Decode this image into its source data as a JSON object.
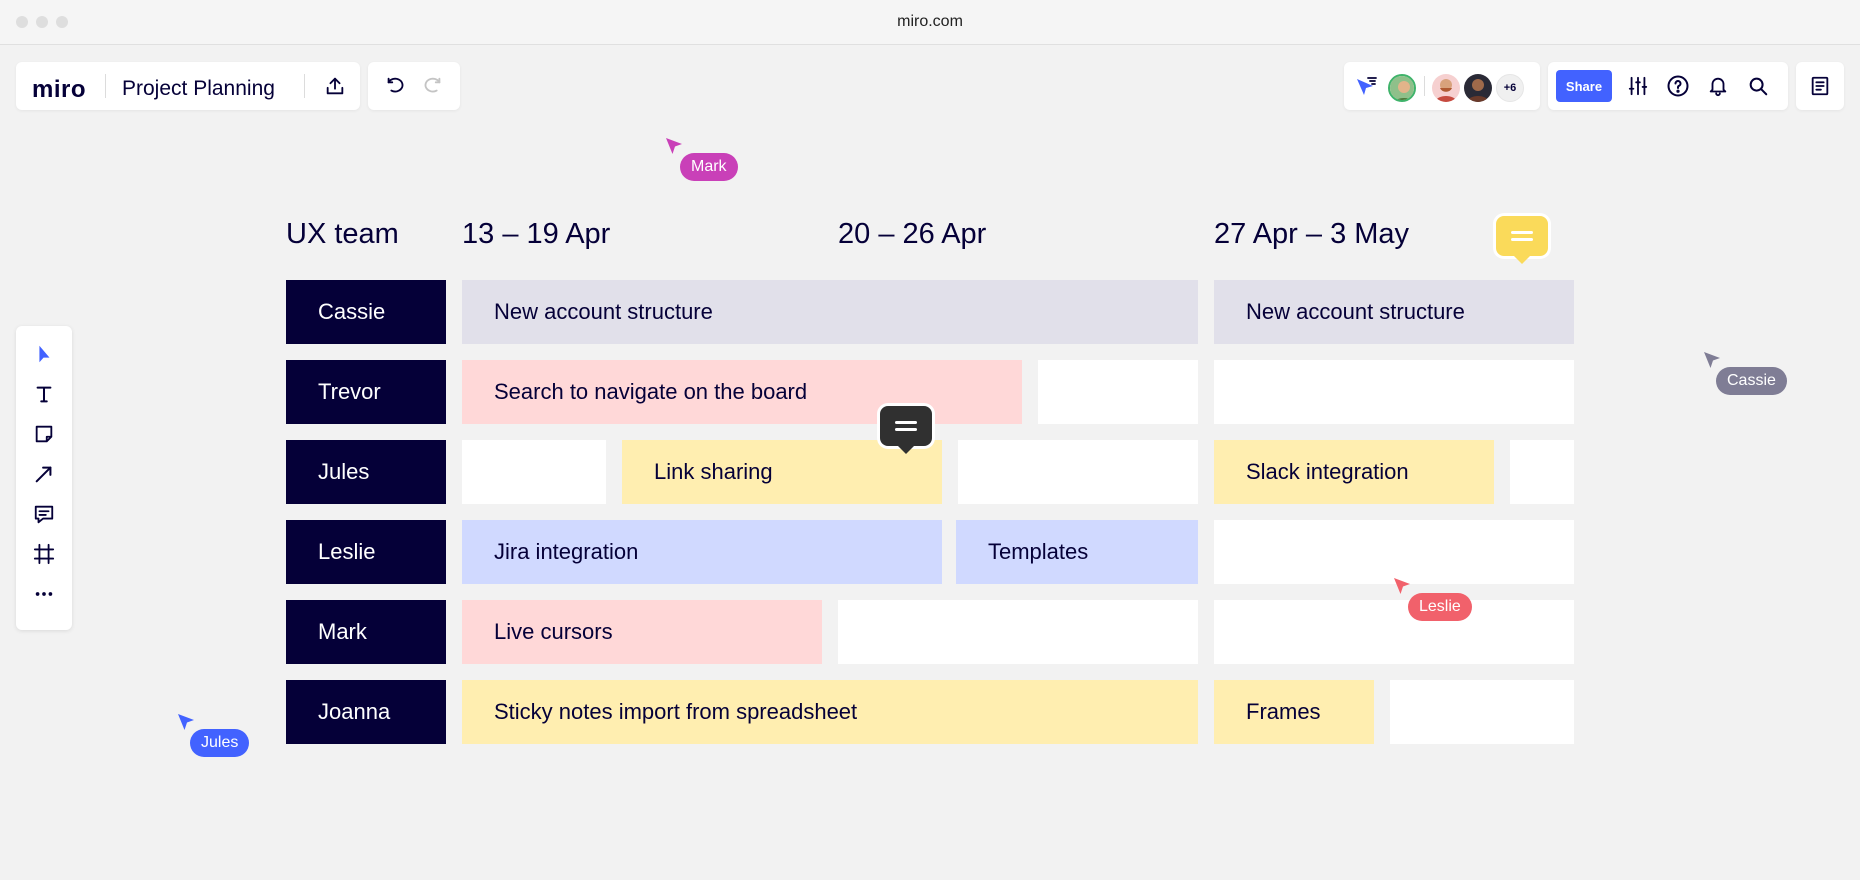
{
  "browser": {
    "url": "miro.com"
  },
  "app": {
    "logo": "miro",
    "board_title": "Project Planning"
  },
  "header": {
    "share_label": "Share",
    "collaborators_more": "+6"
  },
  "board": {
    "team_label": "UX team",
    "weeks": [
      "13 – 19 Apr",
      "20 – 26 Apr",
      "27 Apr – 3 May"
    ],
    "members": [
      "Cassie",
      "Trevor",
      "Jules",
      "Leslie",
      "Mark",
      "Joanna"
    ],
    "tasks": {
      "cassie_1": "New account structure",
      "cassie_2": "New account structure",
      "trevor_1": "Search to navigate on the board",
      "jules_1": "Link sharing",
      "jules_2": "Slack integration",
      "leslie_1": "Jira integration",
      "leslie_2": "Templates",
      "mark_1": "Live cursors",
      "joanna_1": "Sticky notes import from spreadsheet",
      "joanna_2": "Frames"
    }
  },
  "cursors": {
    "mark": "Mark",
    "cassie": "Cassie",
    "leslie": "Leslie",
    "jules": "Jules"
  },
  "colors": {
    "accent": "#4262ff",
    "navy": "#050038",
    "lavender": "#e1e0ea",
    "pink": "#ffd8d8",
    "yellow": "#ffeeb0",
    "blue": "#d0d9ff",
    "comment_yellow": "#fada5a",
    "comment_dark": "#303030",
    "cursor_mark": "#c940b8",
    "cursor_cassie": "#7f7d95",
    "cursor_leslie": "#f1616b",
    "cursor_jules": "#4262ff"
  },
  "icons": {
    "export": "upload-icon",
    "undo": "undo-icon",
    "redo": "redo-icon",
    "filter": "cursor-filter-icon",
    "settings": "sliders-icon",
    "help": "help-icon",
    "notifications": "bell-icon",
    "search": "search-icon",
    "notes": "notes-icon",
    "tools": [
      "select-tool-icon",
      "text-tool-icon",
      "sticky-note-icon",
      "line-tool-icon",
      "comment-tool-icon",
      "frame-tool-icon",
      "more-icon"
    ]
  }
}
